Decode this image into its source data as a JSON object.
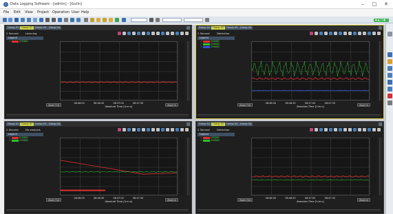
{
  "window": {
    "title": "Data Logging Software - [admin] - [Gutin]",
    "minimize": "–",
    "maximize": "□",
    "close": "✕"
  },
  "menu": [
    "File",
    "Edit",
    "View",
    "Project",
    "Operation",
    "User",
    "Help"
  ],
  "status_pill": "◆ ▲ ▢ ●",
  "panels": [
    {
      "id": "tl",
      "tabs": [
        "Group 01",
        "Group 02",
        "Group 03",
        "Group 04"
      ],
      "active_tab": 1,
      "interval": "2 Second",
      "mode": "Learning",
      "legend_title": "Legend",
      "legend": [
        {
          "label": "CH0001",
          "color": "#e03030"
        }
      ],
      "x_ticks": [
        "08:46:00",
        "08:46:30",
        "08:47:00",
        "08:47:30"
      ],
      "x_label": "Absolute Time [h:m:s]",
      "btn_left": "Zoom Out",
      "btn_right": "Zoom In"
    },
    {
      "id": "tr",
      "tabs": [
        "Group 01",
        "Group 02",
        "Group 03",
        "Group 04"
      ],
      "active_tab": 1,
      "interval": "2 Second",
      "mode": "Detection",
      "legend_title": "Legend",
      "legend": [
        {
          "label": "CH0001",
          "color": "#e03030"
        },
        {
          "label": "CH0002",
          "color": "#30c030"
        },
        {
          "label": "CH0003",
          "color": "#3050e0"
        }
      ],
      "x_ticks": [
        "08:46:00",
        "08:46:30",
        "08:47:00",
        "08:47:30"
      ],
      "x_label": "Absolute Time [h:m:s]",
      "btn_left": "Zoom Out",
      "btn_right": "Zoom In"
    },
    {
      "id": "bl",
      "tabs": [
        "Group 01",
        "Group 02",
        "Group 03",
        "Group 04"
      ],
      "active_tab": 1,
      "interval": "2 Second",
      "mode": "No analysis",
      "legend_title": "Legend",
      "legend": [
        {
          "label": "CH0001",
          "color": "#e03030"
        },
        {
          "label": "CH0002",
          "color": "#30c030"
        }
      ],
      "x_ticks": [
        "08:46:00",
        "08:46:30",
        "08:47:00",
        "08:47:30"
      ],
      "x_label": "Absolute Time [h:m:s]",
      "btn_left": "Zoom Out",
      "btn_right": "Zoom In"
    },
    {
      "id": "br",
      "tabs": [
        "Group 01",
        "Group 02",
        "Group 03",
        "Group 04"
      ],
      "active_tab": 1,
      "interval": "2 Second",
      "mode": "Detection",
      "legend_title": "Legend",
      "legend": [
        {
          "label": "CH0001",
          "color": "#e03030"
        },
        {
          "label": "CH0002",
          "color": "#30c030"
        }
      ],
      "x_ticks": [
        "08:46:00",
        "08:46:30",
        "08:47:00",
        "08:47:30"
      ],
      "x_label": "Absolute Time [h:m:s]",
      "btn_left": "Zoom Out",
      "btn_right": "Zoom In"
    }
  ],
  "colors": {
    "selected_border": "#d6c74a",
    "active_tab": "#cfd84a",
    "series_red": "#e03030",
    "series_green": "#30c030",
    "series_blue": "#3050e0"
  }
}
